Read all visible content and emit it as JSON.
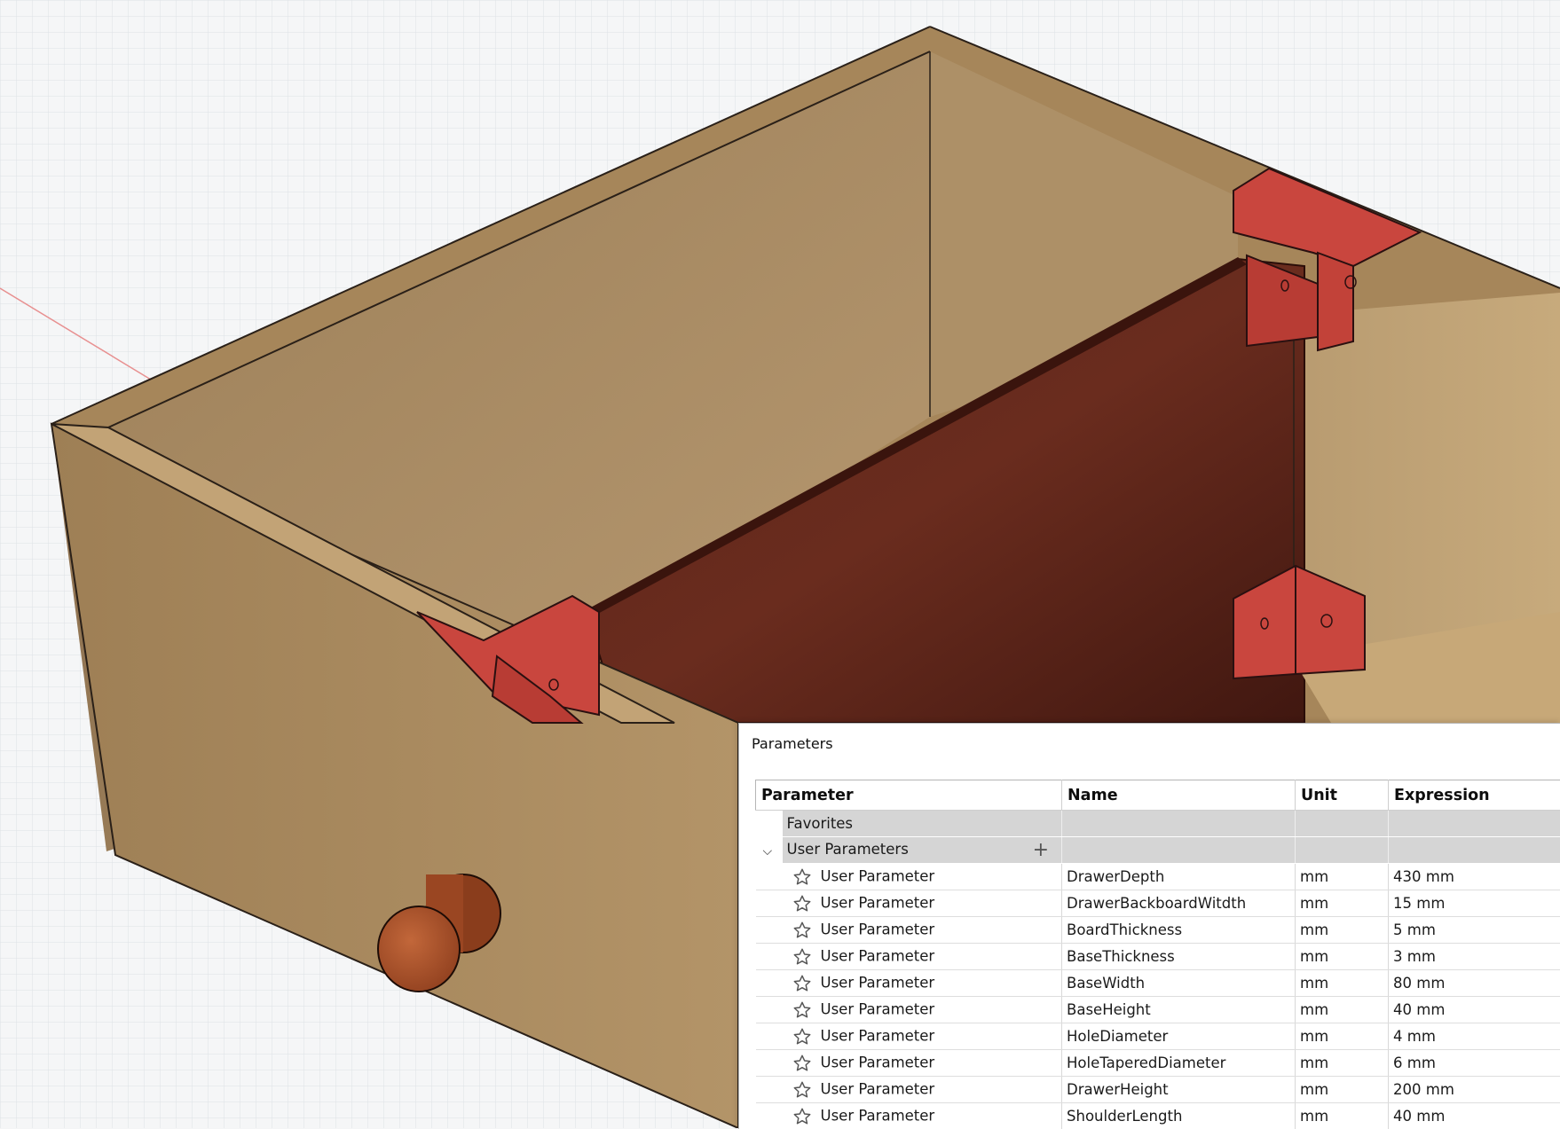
{
  "panel": {
    "title": "Parameters",
    "columns": {
      "parameter": "Parameter",
      "name": "Name",
      "unit": "Unit",
      "expression": "Expression"
    },
    "groups": {
      "favorites": "Favorites",
      "user": "User Parameters"
    },
    "rows": [
      {
        "type": "User Parameter",
        "name": "DrawerDepth",
        "unit": "mm",
        "expression": "430 mm"
      },
      {
        "type": "User Parameter",
        "name": "DrawerBackboardWitdth",
        "unit": "mm",
        "expression": "15 mm"
      },
      {
        "type": "User Parameter",
        "name": "BoardThickness",
        "unit": "mm",
        "expression": "5 mm"
      },
      {
        "type": "User Parameter",
        "name": "BaseThickness",
        "unit": "mm",
        "expression": "3 mm"
      },
      {
        "type": "User Parameter",
        "name": "BaseWidth",
        "unit": "mm",
        "expression": "80 mm"
      },
      {
        "type": "User Parameter",
        "name": "BaseHeight",
        "unit": "mm",
        "expression": "40 mm"
      },
      {
        "type": "User Parameter",
        "name": "HoleDiameter",
        "unit": "mm",
        "expression": "4 mm"
      },
      {
        "type": "User Parameter",
        "name": "HoleTaperedDiameter",
        "unit": "mm",
        "expression": "6 mm"
      },
      {
        "type": "User Parameter",
        "name": "DrawerHeight",
        "unit": "mm",
        "expression": "200 mm"
      },
      {
        "type": "User Parameter",
        "name": "ShoulderLength",
        "unit": "mm",
        "expression": "40 mm"
      }
    ]
  },
  "icons": {
    "favorite": "star-outline-icon",
    "add": "plus-icon",
    "expand": "chevron-down-icon"
  },
  "colors": {
    "wood": "#a6865a",
    "divider": "#4f1d14",
    "bracket": "#c9463e",
    "knob": "#a4502a",
    "grid": "#d6dbe0"
  }
}
